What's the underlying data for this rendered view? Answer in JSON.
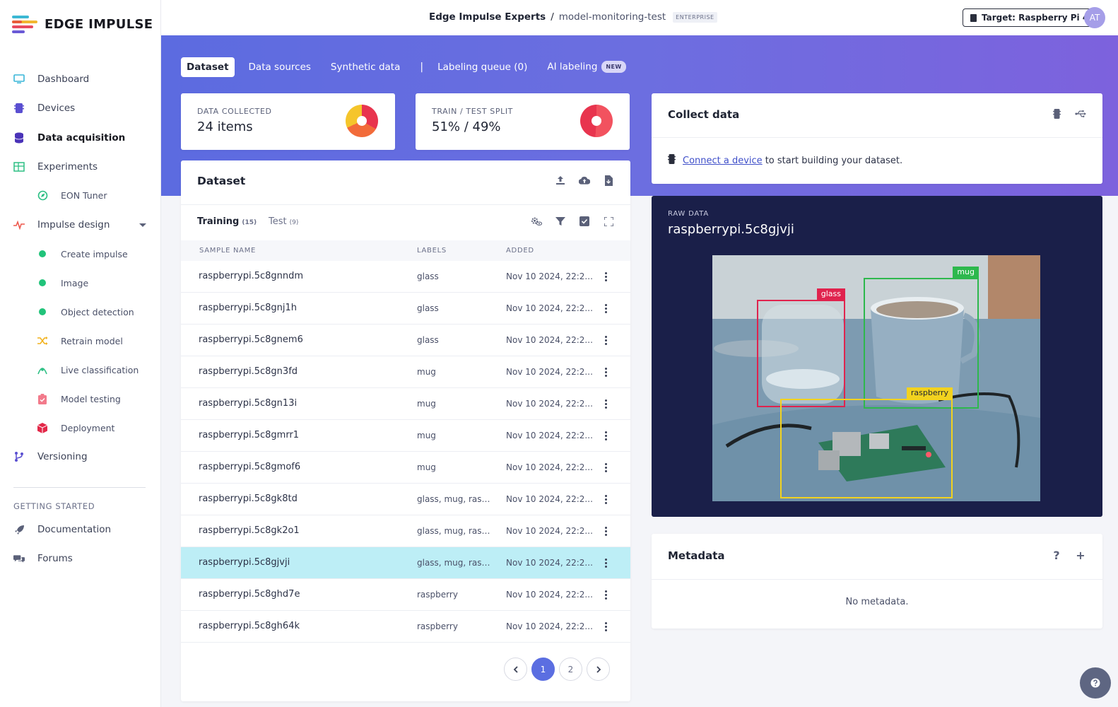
{
  "brand": {
    "name": "EDGE IMPULSE"
  },
  "sidebar": {
    "items": [
      {
        "label": "Dashboard",
        "icon": "monitor-icon"
      },
      {
        "label": "Devices",
        "icon": "chip-icon"
      },
      {
        "label": "Data acquisition",
        "icon": "database-icon"
      },
      {
        "label": "Experiments",
        "icon": "table-icon"
      },
      {
        "label": "EON Tuner",
        "icon": "compass-icon"
      },
      {
        "label": "Impulse design",
        "icon": "pulse-icon"
      },
      {
        "label": "Create impulse",
        "icon": "status-dot-icon"
      },
      {
        "label": "Image",
        "icon": "status-dot-icon"
      },
      {
        "label": "Object detection",
        "icon": "status-dot-icon"
      },
      {
        "label": "Retrain model",
        "icon": "shuffle-icon"
      },
      {
        "label": "Live classification",
        "icon": "signal-icon"
      },
      {
        "label": "Model testing",
        "icon": "clipboard-check-icon"
      },
      {
        "label": "Deployment",
        "icon": "box-icon"
      },
      {
        "label": "Versioning",
        "icon": "branch-icon"
      }
    ],
    "section_title": "GETTING STARTED",
    "footer_items": [
      {
        "label": "Documentation",
        "icon": "rocket-icon"
      },
      {
        "label": "Forums",
        "icon": "chat-icon"
      }
    ]
  },
  "header": {
    "org": "Edge Impulse Experts",
    "separator": "/",
    "project": "model-monitoring-test",
    "badge": "ENTERPRISE",
    "target_label": "Target: Raspberry Pi 4",
    "avatar_initials": "AT"
  },
  "tabs": {
    "items": [
      "Dataset",
      "Data sources",
      "Synthetic data"
    ],
    "separator": "|",
    "labeling_queue": "Labeling queue (0)",
    "ai_labeling": "AI labeling",
    "new_badge": "NEW"
  },
  "stats": {
    "data_collected": {
      "label": "DATA COLLECTED",
      "value": "24 items"
    },
    "split": {
      "label": "TRAIN / TEST SPLIT",
      "value": "51% / 49%"
    }
  },
  "dataset": {
    "title": "Dataset",
    "subtabs": [
      {
        "label": "Training",
        "count": "(15)"
      },
      {
        "label": "Test",
        "count": "(9)"
      }
    ],
    "columns": [
      "SAMPLE NAME",
      "LABELS",
      "ADDED"
    ],
    "rows": [
      {
        "name": "raspberrypi.5c8gnndm",
        "labels": "glass",
        "added": "Nov 10 2024, 22:2..."
      },
      {
        "name": "raspberrypi.5c8gnj1h",
        "labels": "glass",
        "added": "Nov 10 2024, 22:2..."
      },
      {
        "name": "raspberrypi.5c8gnem6",
        "labels": "glass",
        "added": "Nov 10 2024, 22:2..."
      },
      {
        "name": "raspberrypi.5c8gn3fd",
        "labels": "mug",
        "added": "Nov 10 2024, 22:2..."
      },
      {
        "name": "raspberrypi.5c8gn13i",
        "labels": "mug",
        "added": "Nov 10 2024, 22:2..."
      },
      {
        "name": "raspberrypi.5c8gmrr1",
        "labels": "mug",
        "added": "Nov 10 2024, 22:2..."
      },
      {
        "name": "raspberrypi.5c8gmof6",
        "labels": "mug",
        "added": "Nov 10 2024, 22:2..."
      },
      {
        "name": "raspberrypi.5c8gk8td",
        "labels": "glass, mug, raspb...",
        "added": "Nov 10 2024, 22:2..."
      },
      {
        "name": "raspberrypi.5c8gk2o1",
        "labels": "glass, mug, raspb...",
        "added": "Nov 10 2024, 22:2..."
      },
      {
        "name": "raspberrypi.5c8gjvji",
        "labels": "glass, mug, raspb...",
        "added": "Nov 10 2024, 22:2...",
        "selected": true
      },
      {
        "name": "raspberrypi.5c8ghd7e",
        "labels": "raspberry",
        "added": "Nov 10 2024, 22:2..."
      },
      {
        "name": "raspberrypi.5c8gh64k",
        "labels": "raspberry",
        "added": "Nov 10 2024, 22:2..."
      }
    ],
    "pages": [
      "1",
      "2"
    ],
    "current_page": "1"
  },
  "collect": {
    "title": "Collect data",
    "link_text": "Connect a device",
    "rest_text": "to start building your dataset."
  },
  "raw_data": {
    "label": "RAW DATA",
    "sample_name": "raspberrypi.5c8gjvji",
    "boxes": [
      {
        "label": "glass",
        "color": "#e0234e"
      },
      {
        "label": "mug",
        "color": "#2db84d"
      },
      {
        "label": "raspberry",
        "color": "#f2d21f"
      }
    ]
  },
  "metadata": {
    "title": "Metadata",
    "empty_text": "No metadata.",
    "help_label": "?",
    "add_label": "+"
  },
  "colors": {
    "accent": "#5b6ee1",
    "selected_row": "#bdeef6",
    "raw_panel": "#1a1f49"
  }
}
